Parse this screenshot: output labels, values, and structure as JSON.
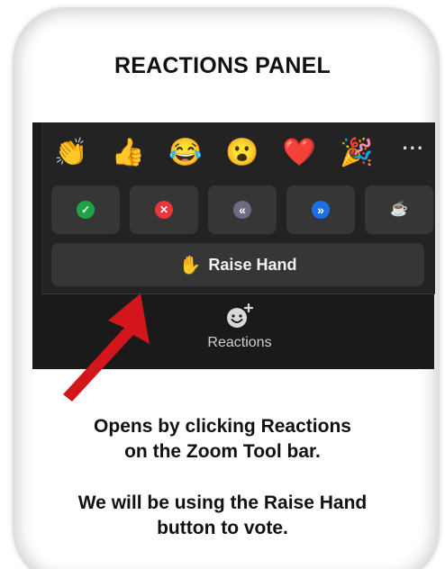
{
  "title": "REACTIONS PANEL",
  "panel": {
    "emojis": [
      {
        "name": "clapping-hands-icon",
        "glyph": "👏"
      },
      {
        "name": "thumbs-up-icon",
        "glyph": "👍"
      },
      {
        "name": "tears-of-joy-icon",
        "glyph": "😂"
      },
      {
        "name": "surprised-face-icon",
        "glyph": "😮"
      },
      {
        "name": "red-heart-icon",
        "glyph": "❤️"
      },
      {
        "name": "party-popper-icon",
        "glyph": "🎉"
      }
    ],
    "more_glyph": "···",
    "buttons": [
      {
        "name": "yes-button",
        "icon": "check-icon",
        "glyph": "✓",
        "color": "#1ea446"
      },
      {
        "name": "no-button",
        "icon": "x-icon",
        "glyph": "✕",
        "color": "#e8363c"
      },
      {
        "name": "slow-down-button",
        "icon": "rewind-icon",
        "glyph": "«",
        "color": "#6b6b84"
      },
      {
        "name": "speed-up-button",
        "icon": "fast-forward-icon",
        "glyph": "»",
        "color": "#1e6ee8"
      },
      {
        "name": "away-button",
        "icon": "coffee-cup-icon",
        "glyph": "☕",
        "color": "transparent"
      }
    ],
    "raise_hand": {
      "glyph": "✋",
      "label": "Raise Hand"
    }
  },
  "toolbar": {
    "reactions_label": "Reactions"
  },
  "caption": {
    "line1": "Opens by clicking Reactions",
    "line2": "on the Zoom Tool bar.",
    "line3": "We will be using the Raise Hand",
    "line4": "button to vote."
  },
  "colors": {
    "arrow": "#d3161c",
    "panel_bg": "#232323",
    "tile_bg": "#363636"
  }
}
